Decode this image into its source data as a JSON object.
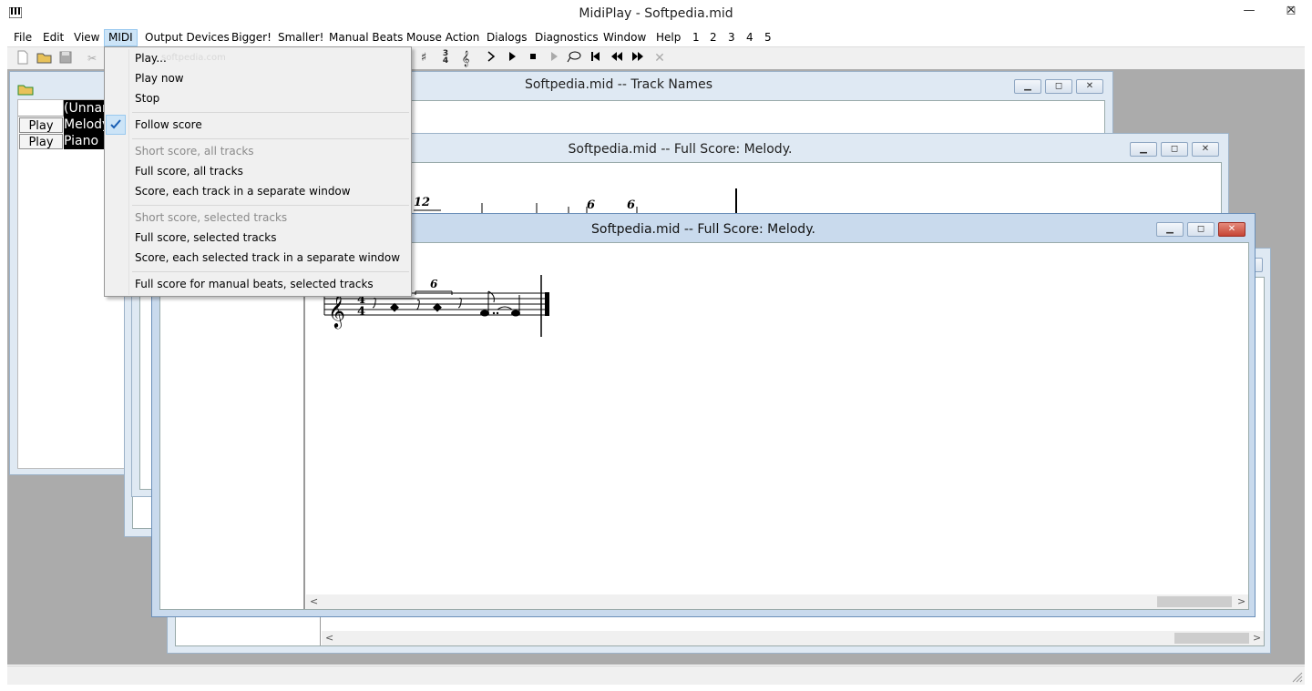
{
  "app": {
    "title": "MidiPlay - Softpedia.mid",
    "window_buttons": {
      "minimize": "—",
      "maximize": "☐",
      "close": "✕"
    }
  },
  "menubar": [
    "File",
    "Edit",
    "View",
    "MIDI",
    "Output Devices",
    "Bigger!",
    "Smaller!",
    "Manual Beats",
    "Mouse Action",
    "Dialogs",
    "Diagnostics",
    "Window",
    "Help",
    "1",
    "2",
    "3",
    "4",
    "5"
  ],
  "midi_menu": {
    "items": [
      {
        "label": "Play...",
        "enabled": true
      },
      {
        "label": "Play now",
        "enabled": true
      },
      {
        "label": "Stop",
        "enabled": true
      },
      {
        "label": "Follow score",
        "enabled": true,
        "checked": true
      },
      {
        "label": "Short score, all tracks",
        "enabled": false
      },
      {
        "label": "Full score, all tracks",
        "enabled": true
      },
      {
        "label": "Score, each track in a separate window",
        "enabled": true
      },
      {
        "label": "Short score, selected tracks",
        "enabled": false
      },
      {
        "label": "Full score, selected tracks",
        "enabled": true
      },
      {
        "label": "Score, each selected track in a separate window",
        "enabled": true
      },
      {
        "label": "Full score for manual beats, selected tracks",
        "enabled": true
      }
    ],
    "watermark": "softpedia.com"
  },
  "toolbar": {
    "icons": [
      "new-file-icon",
      "open-folder-icon",
      "save-icon",
      "cut-icon",
      "key-signature-icon",
      "time-signature-icon",
      "clef-icon",
      "next-icon",
      "play-icon",
      "stop-icon",
      "play-disabled-icon",
      "loop-icon",
      "skip-to-start-icon",
      "rewind-icon",
      "fast-forward-icon",
      "cancel-icon"
    ],
    "time_sig_top": "3",
    "time_sig_bottom": "4"
  },
  "track_list_window": {
    "rows": [
      {
        "button": "",
        "name": "(Unnamed)"
      },
      {
        "button": "Play",
        "name": "Melody"
      },
      {
        "button": "Play",
        "name": "Piano"
      }
    ]
  },
  "windows": {
    "track_names": "Softpedia.mid -- Track Names",
    "full_score_back": "Softpedia.mid -- Full Score: Melody.",
    "full_score_front": "Softpedia.mid -- Full Score: Melody."
  },
  "score": {
    "time_signature": {
      "top": "4",
      "bottom": "4"
    },
    "tuplet_front": "6",
    "tuplets_back": [
      "12",
      "6",
      "6"
    ]
  },
  "colors": {
    "active_frame": "#c9daed",
    "inactive_frame": "#dfe9f3",
    "menu_highlight": "#cce4f7",
    "close_red": "#c64434",
    "mdi_background": "#ababab"
  }
}
